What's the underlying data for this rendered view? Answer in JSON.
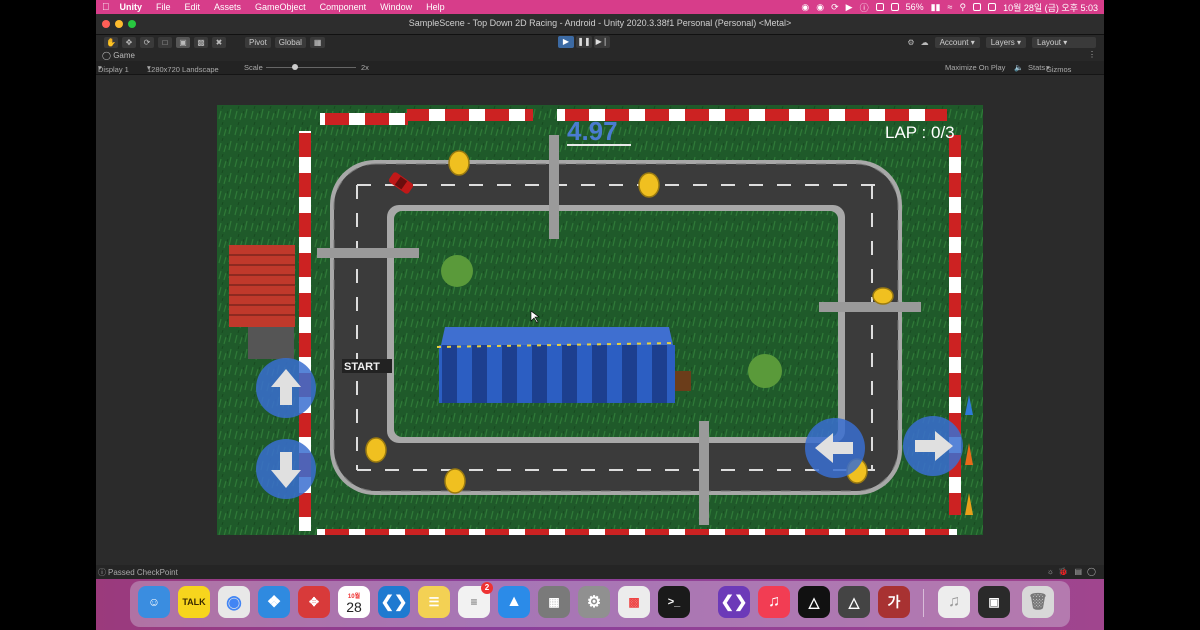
{
  "menubar": {
    "apple": "",
    "app": "Unity",
    "items": [
      "File",
      "Edit",
      "Assets",
      "GameObject",
      "Component",
      "Window",
      "Help"
    ],
    "battery": "56%",
    "clock": "10월 28일 (금) 오후 5:03"
  },
  "window": {
    "title": "SampleScene - Top Down 2D Racing - Android - Unity 2020.3.38f1 Personal (Personal) <Metal>"
  },
  "toolbar": {
    "pivot": "Pivot",
    "global": "Global",
    "account": "Account",
    "layers": "Layers",
    "layout": "Layout"
  },
  "gameview": {
    "tab": "Game",
    "display": "Display 1",
    "resolution": "1280x720 Landscape",
    "scale_label": "Scale",
    "scale_value": "2x",
    "maximize": "Maximize On Play",
    "stats": "Stats",
    "gizmos": "Gizmos"
  },
  "game": {
    "timer": "4.97",
    "lap": "LAP : 0/3",
    "start": "START"
  },
  "status": {
    "message": "Passed CheckPoint"
  },
  "dock": {
    "kakao": "TALK",
    "calendar_month": "10월",
    "calendar_day": "28",
    "reminders_badge": "2",
    "hangul": "가"
  },
  "colors": {
    "menubar": "#d73d8a",
    "grass": "#1f5a2a",
    "road": "#3b3b3b",
    "timer": "#4a7cd0"
  }
}
